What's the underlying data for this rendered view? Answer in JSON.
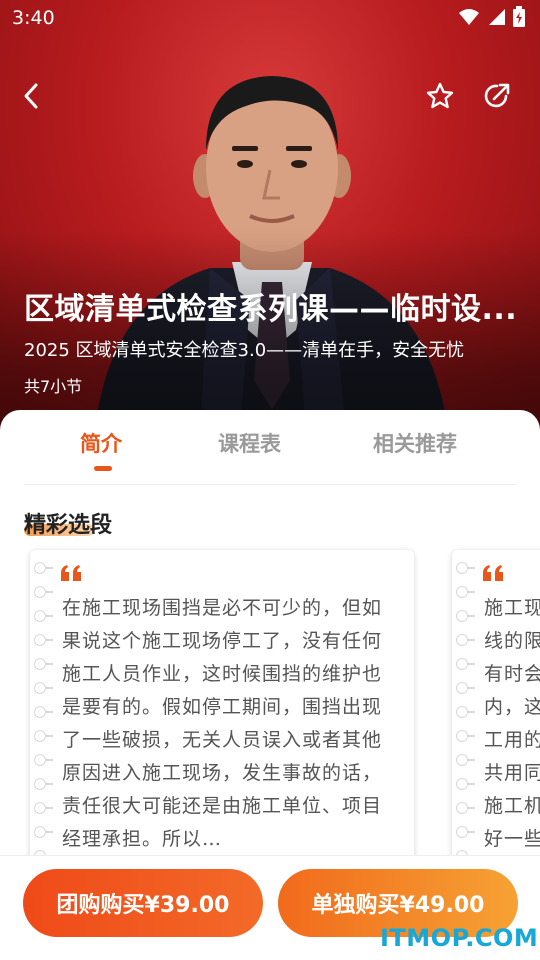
{
  "status_bar": {
    "time": "3:40"
  },
  "course": {
    "title": "区域清单式检查系列课——临时设...",
    "subtitle": "2025 区域清单式安全检查3.0——清单在手，安全无忧",
    "lessons": "共7小节"
  },
  "tabs": [
    {
      "label": "简介",
      "active": true
    },
    {
      "label": "课程表",
      "active": false
    },
    {
      "label": "相关推荐",
      "active": false
    }
  ],
  "section": {
    "title": "精彩选段"
  },
  "quotes": [
    {
      "text": "在施工现场围挡是必不可少的，但如果说这个施工现场停工了，没有任何施工人员作业，这时候围挡的维护也是要有的。假如停工期间，围挡出现了一些破损，无关人员误入或者其他原因进入施工现场，发生事故的话，责任很大可能还是由施工单位、项目经理承担。所以…"
    },
    {
      "text": "施工现线的限有时会内，这工用的共用同施工机好一些"
    }
  ],
  "buttons": {
    "group_buy": "团购购买¥39.00",
    "single_buy": "单独购买¥49.00"
  },
  "watermark": "ITMOP.COM",
  "colors": {
    "accent": "#e8561a",
    "hero_red": "#b81c1f",
    "watermark": "#17a8d8"
  }
}
